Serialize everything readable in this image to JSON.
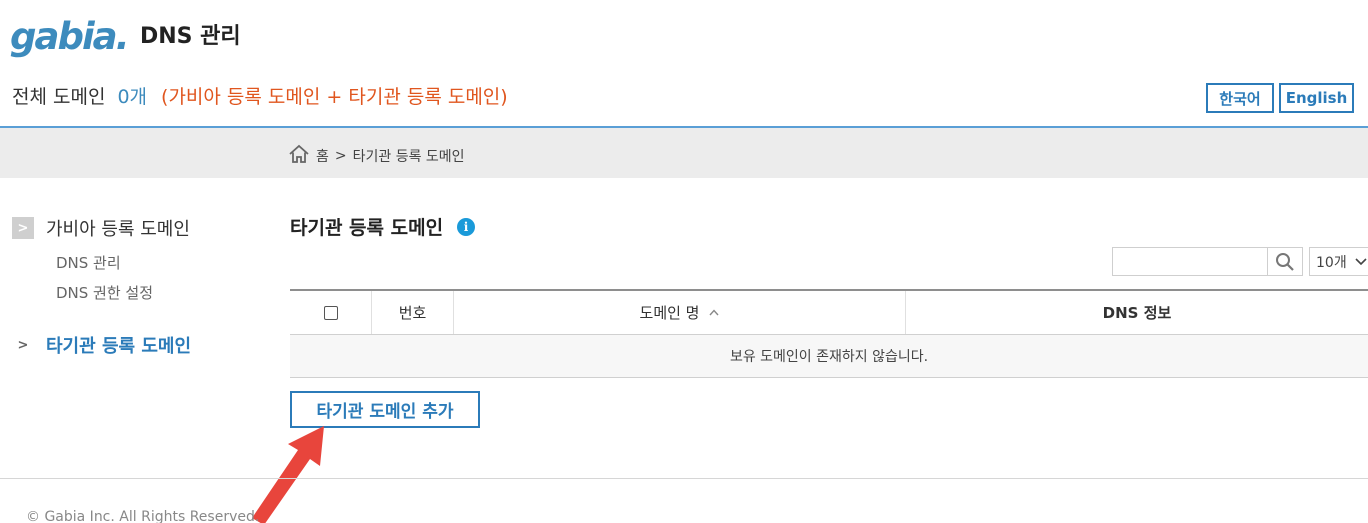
{
  "header": {
    "logo_text": "gabia.",
    "app_title": "DNS 관리",
    "summary_label": "전체 도메인",
    "summary_count": "0개",
    "summary_note": "(가비아 등록 도메인 + 타기관 등록 도메인)",
    "lang_korean": "한국어",
    "lang_english": "English"
  },
  "breadcrumb": {
    "home_icon": "home-icon",
    "home": "홈",
    "separator": ">",
    "current": "타기관 등록 도메인"
  },
  "sidebar": {
    "gabia_domains": "가비아 등록 도메인",
    "dns_manage": "DNS 관리",
    "dns_permission": "DNS 권한 설정",
    "other_domains": "타기관 등록 도메인"
  },
  "main": {
    "title": "타기관 등록 도메인",
    "info_icon": "i",
    "page_size": "10개",
    "columns": {
      "number": "번호",
      "domain_name": "도메인 명",
      "dns_info": "DNS 정보"
    },
    "empty_message": "보유 도메인이 존재하지 않습니다.",
    "add_button": "타기관 도메인 추가"
  },
  "footer": {
    "copyright": "© Gabia Inc. All Rights Reserved."
  },
  "colors": {
    "accent": "#2b7bb9",
    "logo": "#3d8bbd",
    "note": "#e0561f",
    "annotation_arrow": "#e8453c"
  }
}
